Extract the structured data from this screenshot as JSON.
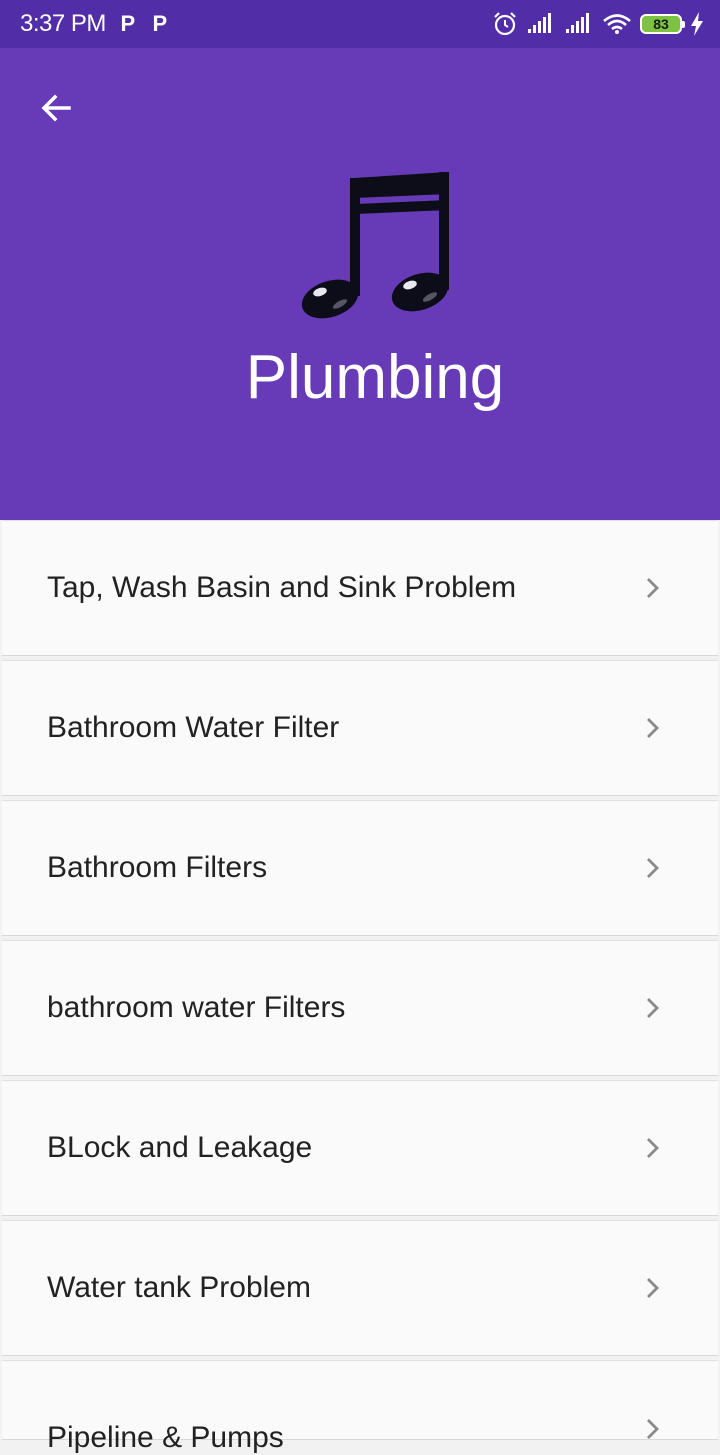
{
  "status_bar": {
    "time": "3:37 PM",
    "notif_icons": [
      "P",
      "P"
    ],
    "battery": "83",
    "icons": [
      "alarm-icon",
      "signal-icon",
      "signal-icon",
      "wifi-icon",
      "battery-icon",
      "charging-icon"
    ]
  },
  "header": {
    "title": "Plumbing",
    "back_icon": "arrow-left-icon",
    "hero_icon": "music-note-icon",
    "background": "#673ab7",
    "status_bar_color": "#512da8"
  },
  "list": {
    "items": [
      {
        "label": "Tap, Wash Basin and Sink Problem"
      },
      {
        "label": "Bathroom Water Filter"
      },
      {
        "label": "Bathroom Filters"
      },
      {
        "label": "bathroom water Filters"
      },
      {
        "label": "BLock and Leakage"
      },
      {
        "label": "Water tank Problem"
      },
      {
        "label": "Pipeline & Pumps"
      }
    ]
  }
}
